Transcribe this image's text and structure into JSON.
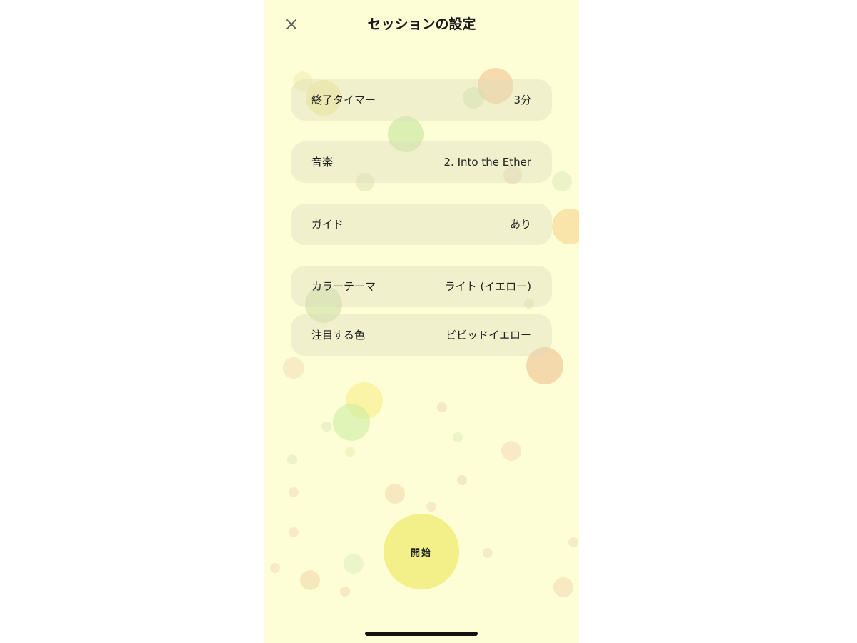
{
  "header": {
    "title": "セッションの設定",
    "close_icon": "close-icon"
  },
  "settings": [
    {
      "label": "終了タイマー",
      "value": "3分"
    },
    {
      "label": "音楽",
      "value": "2. Into the Ether"
    },
    {
      "label": "ガイド",
      "value": "あり"
    },
    {
      "label": "カラーテーマ",
      "value": "ライト (イエロー)"
    },
    {
      "label": "注目する色",
      "value": "ビビッドイエロー"
    }
  ],
  "start_button": {
    "label": "開始"
  },
  "colors": {
    "background": "#fefed6",
    "row_background": "#ecebc6",
    "start_button": "#f3f08a",
    "text": "#222222"
  }
}
